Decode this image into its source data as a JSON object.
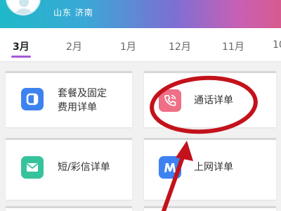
{
  "header": {
    "location": "山东  济南"
  },
  "tabs": [
    {
      "label": "3月",
      "active": true
    },
    {
      "label": "2月",
      "active": false
    },
    {
      "label": "1月",
      "active": false
    },
    {
      "label": "12月",
      "active": false
    },
    {
      "label": "11月",
      "active": false
    },
    {
      "label": "10",
      "active": false
    }
  ],
  "cards": {
    "package": {
      "label_line1": "套餐及固定",
      "label_line2": "费用详单",
      "icon": "package-icon",
      "color": "#3d82f0"
    },
    "call": {
      "label": "通话详单",
      "icon": "phone-call-icon",
      "color": "#ee6f86"
    },
    "sms": {
      "label": "短/彩信详单",
      "icon": "envelope-icon",
      "color": "#36c39b"
    },
    "internet": {
      "label": "上网详单",
      "icon": "internet-icon",
      "color": "#3d82f0"
    }
  },
  "colors": {
    "tab_accent": "#a35ad6",
    "annotation_red": "#c3121b"
  }
}
